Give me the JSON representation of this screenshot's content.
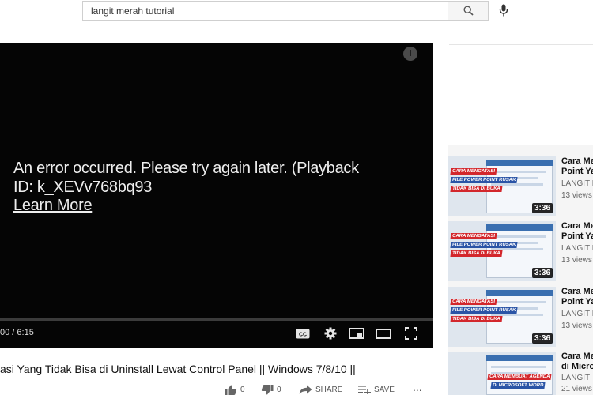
{
  "search": {
    "value": "langit merah tutorial"
  },
  "player": {
    "error_line1": "An error occurred. Please try again later. (Playback",
    "error_line2": "ID: k_XEVv768bq93",
    "learn_more": "Learn More",
    "time": "00 / 6:15",
    "info_glyph": "i"
  },
  "video": {
    "title": "asi Yang Tidak Bisa di Uninstall Lewat Control Panel || Windows 7/8/10 ||",
    "likes": "0",
    "dislikes": "0",
    "share_label": "SHARE",
    "save_label": "SAVE",
    "more_glyph": "..."
  },
  "related": [
    {
      "title_line1": "Cara Me",
      "title_line2": "Point Ya",
      "channel": "LANGIT M",
      "views": "13 views",
      "duration": "3:36",
      "banner1": "CARA MENGATASI",
      "banner2": "FILE POWER POINT RUSAK",
      "banner3": "TIDAK BISA DI BUKA"
    },
    {
      "title_line1": "Cara Me",
      "title_line2": "Point Ya",
      "channel": "LANGIT M",
      "views": "13 views",
      "duration": "3:36",
      "banner1": "CARA MENGATASI",
      "banner2": "FILE POWER POINT RUSAK",
      "banner3": "TIDAK BISA DI BUKA"
    },
    {
      "title_line1": "Cara Me",
      "title_line2": "Point Ya",
      "channel": "LANGIT M",
      "views": "13 views",
      "duration": "3:36",
      "banner1": "CARA MENGATASI",
      "banner2": "FILE POWER POINT RUSAK",
      "banner3": "TIDAK BISA DI BUKA"
    },
    {
      "title_line1": "Cara Me",
      "title_line2": "di Micro",
      "channel": "LANGIT",
      "views": "21 views",
      "banner1": "CARA MEMBUAT AGENDA",
      "banner2": "DI MICROSOFT WORD"
    }
  ],
  "colors": {
    "player_bg": "#050505",
    "error_text": "#eeeeee",
    "banner_red": "#d3272c",
    "banner_blue": "#2a54a6"
  }
}
